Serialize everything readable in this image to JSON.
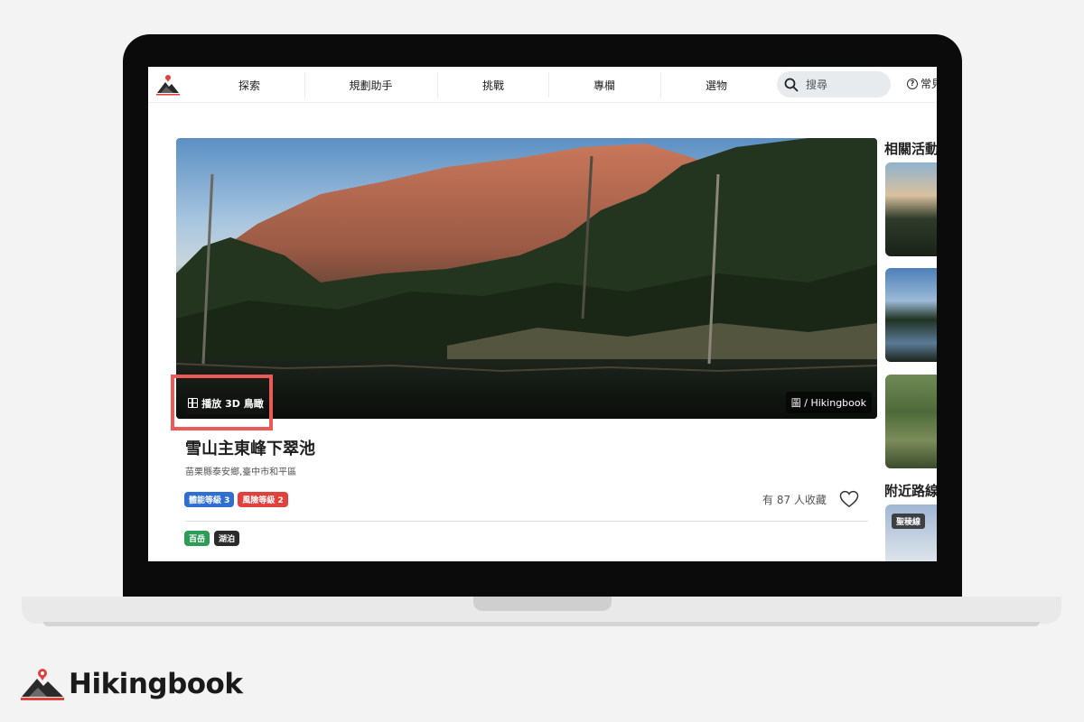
{
  "nav": {
    "items": [
      "探索",
      "規劃助手",
      "挑戰",
      "專欄",
      "選物"
    ],
    "search_placeholder": "搜尋",
    "faq_label": "常見"
  },
  "hero": {
    "photo_credit": "圖 / Hikingbook",
    "play_3d_label": "播放 3D 鳥瞰"
  },
  "trail": {
    "title": "雪山主東峰下翠池",
    "location": "苗栗縣泰安鄉,臺中市和平區",
    "badges": [
      {
        "label": "體能等級 3",
        "color": "#2f6fd1"
      },
      {
        "label": "風險等級 2",
        "color": "#e0413d"
      }
    ],
    "favorites_text": "有 87 人收藏",
    "tags": [
      {
        "label": "百岳",
        "color": "#2e9b58"
      },
      {
        "label": "湖泊",
        "color": "#2b2b2b"
      }
    ]
  },
  "sidebar": {
    "related_heading": "相關活動",
    "nearby_heading": "附近路線",
    "nearby_badge": "聖稜線"
  },
  "brand": {
    "name": "Hikingbook",
    "accent": "#e0413d"
  }
}
